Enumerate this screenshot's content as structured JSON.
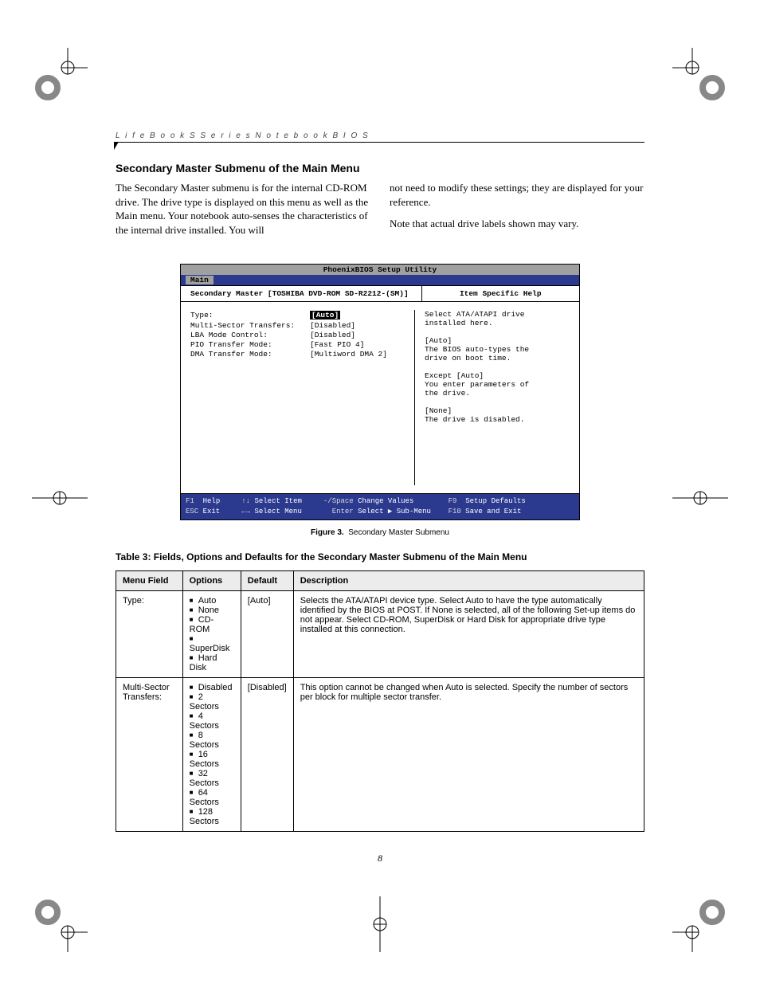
{
  "running_head": "L i f e B o o k   S   S e r i e s   N o t e b o o k   B I O S",
  "section_title": "Secondary Master Submenu of the Main Menu",
  "para1": "The Secondary Master submenu is for the internal CD-ROM drive. The drive type is displayed on this menu as well as the Main menu. Your notebook auto-senses the characteristics of the internal drive installed. You will",
  "para2": "not need to modify these settings;  they are displayed for your reference.",
  "para3": "Note that actual drive labels shown may vary.",
  "bios": {
    "title": "PhoenixBIOS Setup Utility",
    "tab": "Main",
    "subtitle": "Secondary Master [TOSHIBA DVD-ROM SD-R2212-(SM)]",
    "help_title": "Item Specific Help",
    "rows": [
      {
        "lbl": "Type:",
        "val": "[Auto]",
        "hl": true
      },
      {
        "lbl": "",
        "val": ""
      },
      {
        "lbl": "Multi-Sector Transfers:",
        "val": "[Disabled]"
      },
      {
        "lbl": "LBA Mode Control:",
        "val": "[Disabled]"
      },
      {
        "lbl": "PIO Transfer Mode:",
        "val": "[Fast PIO 4]"
      },
      {
        "lbl": "DMA Transfer Mode:",
        "val": "[Multiword DMA 2]"
      }
    ],
    "help_lines": [
      "Select ATA/ATAPI drive",
      "installed here.",
      "",
      "[Auto]",
      "The BIOS auto-types the",
      "drive on boot time.",
      "",
      "Except [Auto]",
      "You enter parameters of",
      "the drive.",
      "",
      "[None]",
      "The drive is disabled."
    ],
    "footer": {
      "f1": "F1",
      "help": "Help",
      "updn": "↑↓",
      "select_item": "Select Item",
      "minus": "-/Space",
      "change": "Change Values",
      "f9": "F9",
      "setup_defaults": "Setup Defaults",
      "esc": "ESC",
      "exit": "Exit",
      "lr": "←→",
      "select_menu": "Select Menu",
      "enter": "Enter",
      "select_sub": "Select ▶ Sub-Menu",
      "f10": "F10",
      "save": "Save and Exit"
    }
  },
  "figure_label": "Figure 3.",
  "figure_title": "Secondary Master Submenu",
  "table_caption": "Table 3: Fields, Options and Defaults for the Secondary Master Submenu of the Main Menu",
  "table": {
    "headers": [
      "Menu Field",
      "Options",
      "Default",
      "Description"
    ],
    "rows": [
      {
        "field": "Type:",
        "options": [
          "Auto",
          "None",
          "CD-ROM",
          "SuperDisk",
          "Hard Disk"
        ],
        "default": "[Auto]",
        "desc": "Selects the ATA/ATAPI device type. Select Auto to have the type automatically identified by the BIOS at POST. If None is selected, all of the following Set-up items do not appear. Select CD-ROM, SuperDisk or Hard Disk for appropriate drive type installed at this connection."
      },
      {
        "field": "Multi-Sector Transfers:",
        "options": [
          "Disabled",
          "2 Sectors",
          "4 Sectors",
          "8 Sectors",
          "16 Sectors",
          "32 Sectors",
          "64 Sectors",
          "128 Sectors"
        ],
        "default": "[Disabled]",
        "desc": "This option cannot be changed when Auto is selected. Specify the number of sectors per block for multiple sector transfer."
      }
    ]
  },
  "page_number": "8"
}
